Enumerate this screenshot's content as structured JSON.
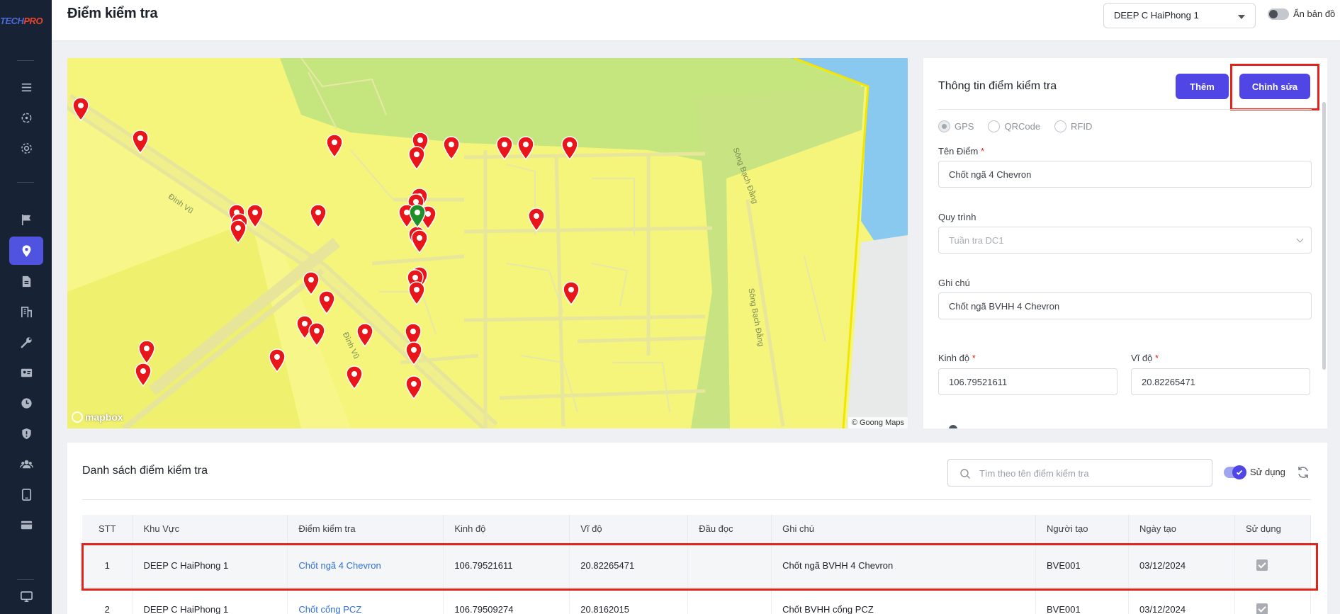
{
  "app": {
    "logo_part1": "TECH",
    "logo_part2": "PRO"
  },
  "header": {
    "title": "Điểm kiểm tra",
    "site_select": "DEEP C HaiPhong 1",
    "hide_map_label": "Ẩn bản đồ"
  },
  "sidebar": {
    "items": [
      {
        "icon": "menu-icon"
      },
      {
        "icon": "target-icon"
      },
      {
        "icon": "gear-icon"
      },
      {
        "icon": "flag-icon"
      },
      {
        "icon": "location-pin-icon",
        "active": true
      },
      {
        "icon": "document-icon"
      },
      {
        "icon": "building-icon"
      },
      {
        "icon": "wrench-icon"
      },
      {
        "icon": "id-card-icon"
      },
      {
        "icon": "clock-icon"
      },
      {
        "icon": "shield-icon"
      },
      {
        "icon": "users-icon"
      },
      {
        "icon": "tablet-icon"
      },
      {
        "icon": "card-icon"
      },
      {
        "icon": "monitor-icon"
      }
    ],
    "active_color": "#4f53e0"
  },
  "map": {
    "mapbox_label": "mapbox",
    "attribution": "© Goong Maps",
    "street_labels": [
      "Đình Vũ",
      "Đình Vũ",
      "Sông Bạch Đằng",
      "Sông Bạch Đằng"
    ],
    "pin_color_default": "#e8151b",
    "pin_color_selected": "#1f8f2a"
  },
  "info": {
    "title": "Thông tin điểm kiểm tra",
    "add_button": "Thêm",
    "edit_button": "Chỉnh sửa",
    "modes": [
      "GPS",
      "QRCode",
      "RFID"
    ],
    "selected_mode": "GPS",
    "name_label": "Tên Điểm",
    "name_value": "Chốt ngã 4 Chevron",
    "process_label": "Quy trình",
    "process_value": "Tuần tra DC1",
    "note_label": "Ghi chú",
    "note_value": "Chốt ngã BVHH 4 Chevron",
    "lng_label": "Kinh độ",
    "lng_value": "106.79521611",
    "lat_label": "Vĩ độ",
    "lat_value": "20.82265471",
    "required_mark": "*"
  },
  "list": {
    "title": "Danh sách điểm kiểm tra",
    "search_placeholder": "Tìm theo tên điểm kiểm tra",
    "use_label": "Sử dụng",
    "columns": [
      "STT",
      "Khu Vực",
      "Điểm kiểm tra",
      "Kinh độ",
      "Vĩ độ",
      "Đầu đọc",
      "Ghi chú",
      "Người tạo",
      "Ngày tạo",
      "Sử dụng"
    ],
    "rows": [
      {
        "stt": "1",
        "area": "DEEP C HaiPhong 1",
        "point": "Chốt ngã 4 Chevron",
        "lng": "106.79521611",
        "lat": "20.82265471",
        "reader": "",
        "note": "Chốt ngã BVHH 4 Chevron",
        "creator": "BVE001",
        "date": "03/12/2024",
        "in_use": true
      },
      {
        "stt": "2",
        "area": "DEEP C HaiPhong 1",
        "point": "Chốt cổng PCZ",
        "lng": "106.79509274",
        "lat": "20.8162015",
        "reader": "",
        "note": "Chốt BVHH cổng PCZ",
        "creator": "BVE001",
        "date": "03/12/2024",
        "in_use": true
      }
    ]
  },
  "colors": {
    "accent": "#4f46e5",
    "highlight": "#e0241b",
    "link": "#2f6fd6"
  }
}
